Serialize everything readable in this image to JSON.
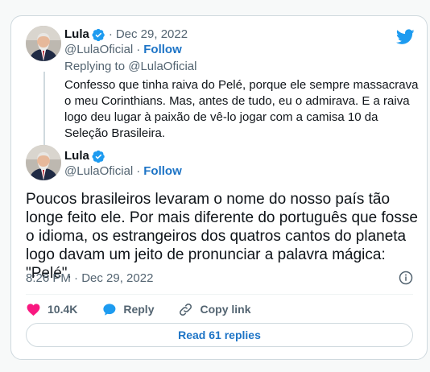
{
  "brand": {
    "accent": "#1d9bf0",
    "like_color": "#f91880",
    "link_color": "#1d74c6"
  },
  "reply_tweet": {
    "author_name": "Lula",
    "date": "Dec 29, 2022",
    "handle": "@LulaOficial",
    "follow_label": "Follow",
    "replying_to": "Replying to @LulaOficial",
    "text": "Confesso que tinha raiva do Pelé, porque ele sempre massacrava o meu Corinthians. Mas, antes de tudo, eu o admirava. E a raiva logo deu lugar à paixão de vê-lo jogar com a camisa 10 da Seleção Brasileira."
  },
  "main_tweet": {
    "author_name": "Lula",
    "handle": "@LulaOficial",
    "follow_label": "Follow",
    "text": "Poucos brasileiros levaram o nome do nosso país tão longe feito ele. Por mais diferente do português que fosse o idioma, os estrangeiros dos quatros cantos do planeta logo davam um jeito de pronunciar a palavra mágica: \"Pelé\".",
    "timestamp": "8:26 PM · Dec 29, 2022"
  },
  "actions": {
    "like_count": "10.4K",
    "reply_label": "Reply",
    "copy_link_label": "Copy link"
  },
  "read_replies_label": "Read 61 replies",
  "icons": [
    "twitter-bird-icon",
    "verified-badge-icon",
    "info-icon",
    "heart-icon",
    "reply-bubble-icon",
    "link-icon"
  ]
}
